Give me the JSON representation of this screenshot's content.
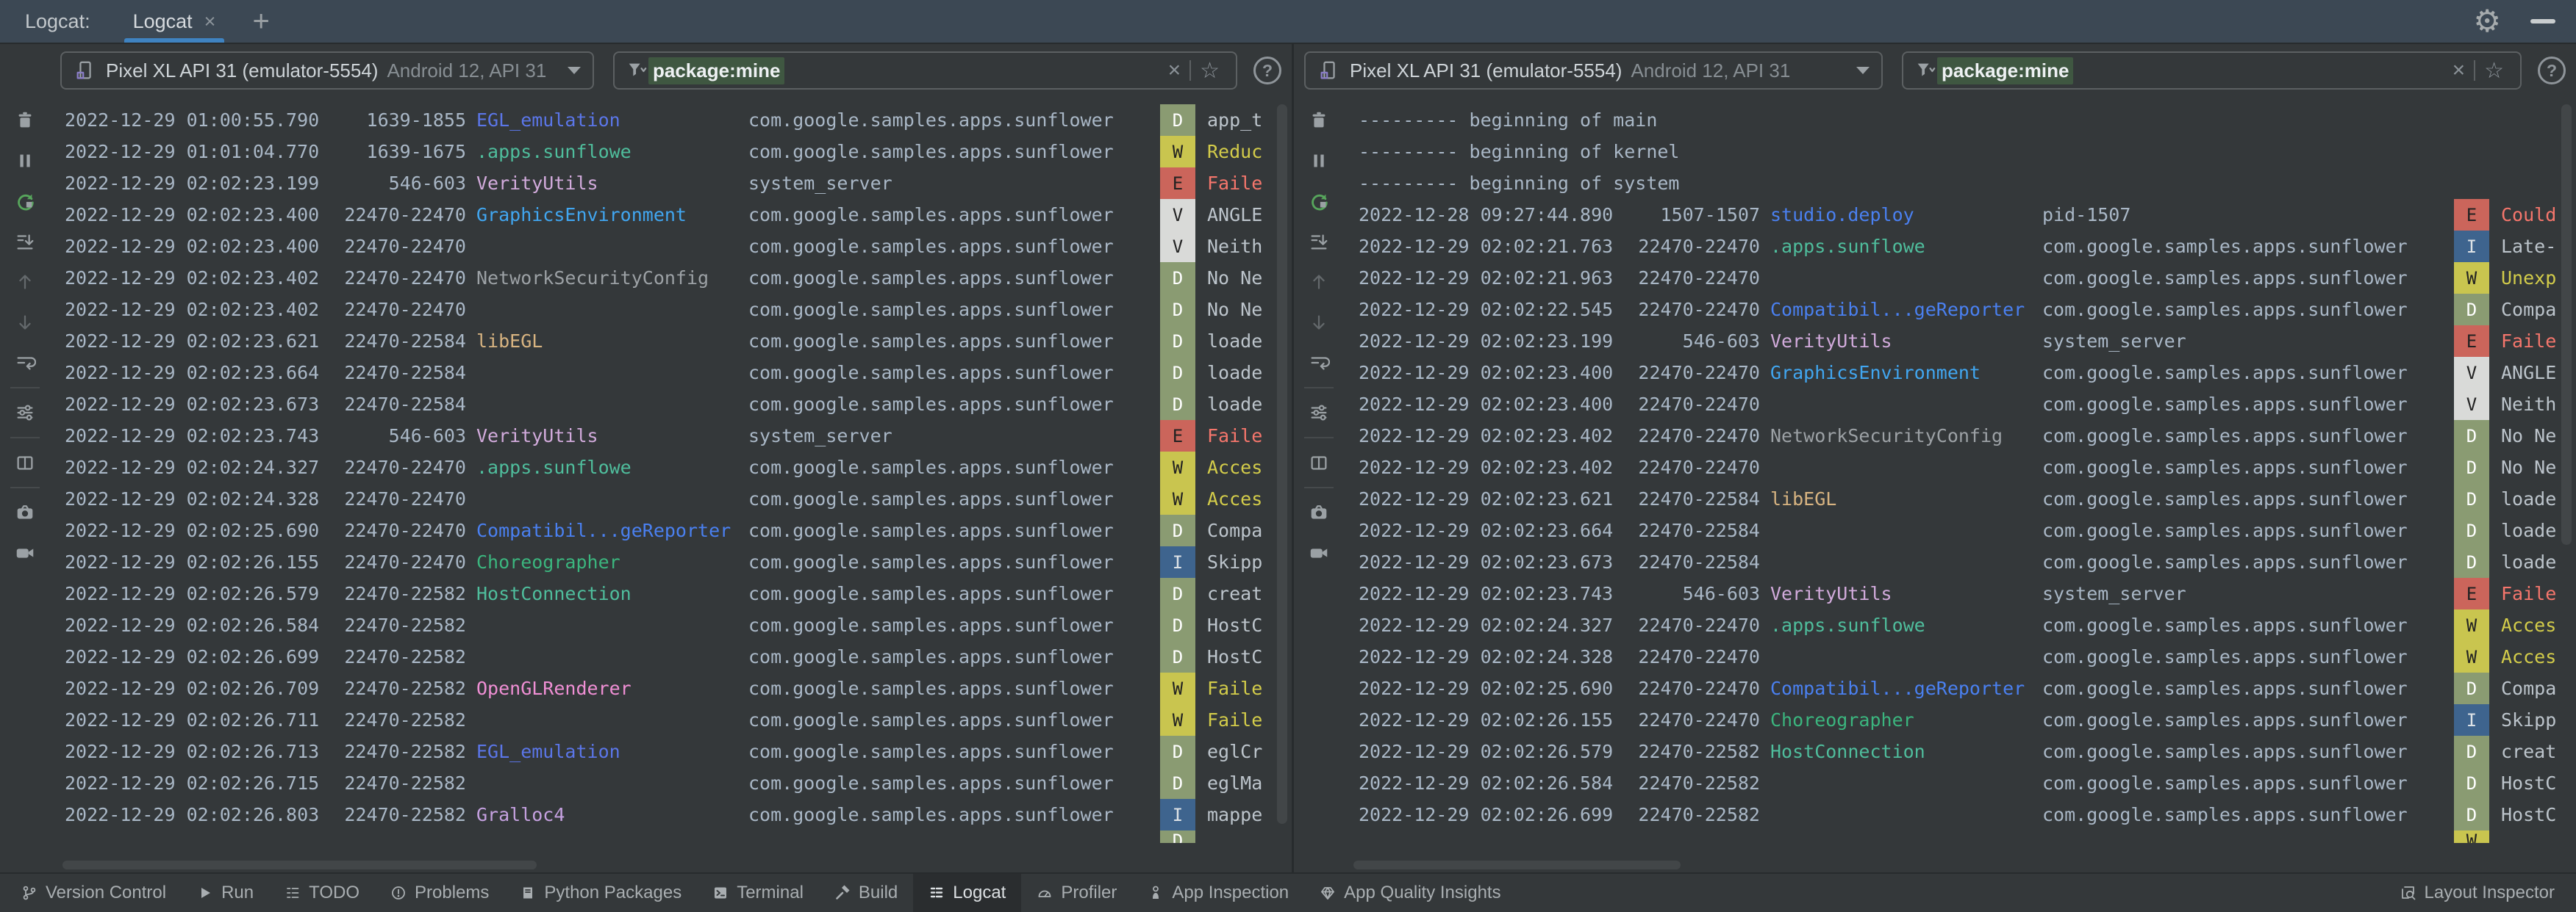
{
  "header": {
    "panel_label": "Logcat:",
    "tab_title": "Logcat",
    "accent_color": "#3f83c1"
  },
  "glyphs": {
    "close": "×",
    "add": "+",
    "clear": "×",
    "favorite": "☆",
    "help": "?",
    "gear": "⚙",
    "filter_caret": "▾"
  },
  "toolbar_icons": [
    "clear-logcat",
    "pause-logcat",
    "restart-logcat",
    "scroll-to-end",
    "previous-occurrence",
    "next-occurrence",
    "soft-wrap",
    "sep",
    "logcat-settings",
    "sep",
    "split-panels",
    "sep",
    "screenshot",
    "screen-record"
  ],
  "levels": {
    "D": {
      "bg": "#8a9b72",
      "fg": "#ffffff",
      "msg": "#bcc4cb"
    },
    "W": {
      "bg": "#c9c54f",
      "fg": "#222222",
      "msg": "#d3cc4a"
    },
    "E": {
      "bg": "#cb655b",
      "fg": "#222222",
      "msg": "#f5766c"
    },
    "V": {
      "bg": "#d9dad8",
      "fg": "#222222",
      "msg": "#bcc4cb"
    },
    "I": {
      "bg": "#3e648e",
      "fg": "#dde2e6",
      "msg": "#bcc4cb"
    }
  },
  "tag_colors": {
    "EGL_emulation": "#5b76e8",
    ".apps.sunflowe": "#4fbd9c",
    "VerityUtils": "#d2abdc",
    "GraphicsEnvironment": "#41a6f0",
    "NetworkSecurityConfig": "#9ca1a5",
    "libEGL": "#d8b481",
    "Compatibil...geReporter": "#4a80f0",
    "Choreographer": "#3bb57e",
    "HostConnection": "#4fbd9c",
    "OpenGLRenderer": "#ef8fd4",
    "Gralloc4": "#c5a1e0",
    "studio.deploy": "#4a80f0"
  },
  "panels": [
    {
      "device": {
        "name": "Pixel XL API 31 (emulator-5554)",
        "details": "Android 12, API 31"
      },
      "filter": {
        "value": "package:mine"
      },
      "rows": [
        {
          "time": "2022-12-29 01:00:55.790",
          "pid": "1639-1855",
          "tag": "EGL_emulation",
          "package": "com.google.samples.apps.sunflower",
          "level": "D",
          "message": "app_t"
        },
        {
          "time": "2022-12-29 01:01:04.770",
          "pid": "1639-1675",
          "tag": ".apps.sunflowe",
          "package": "com.google.samples.apps.sunflower",
          "level": "W",
          "message": "Reduc"
        },
        {
          "time": "2022-12-29 02:02:23.199",
          "pid": "546-603",
          "tag": "VerityUtils",
          "package": "system_server",
          "level": "E",
          "message": "Faile"
        },
        {
          "time": "2022-12-29 02:02:23.400",
          "pid": "22470-22470",
          "tag": "GraphicsEnvironment",
          "package": "com.google.samples.apps.sunflower",
          "level": "V",
          "message": "ANGLE"
        },
        {
          "time": "2022-12-29 02:02:23.400",
          "pid": "22470-22470",
          "tag": "",
          "package": "com.google.samples.apps.sunflower",
          "level": "V",
          "message": "Neith"
        },
        {
          "time": "2022-12-29 02:02:23.402",
          "pid": "22470-22470",
          "tag": "NetworkSecurityConfig",
          "package": "com.google.samples.apps.sunflower",
          "level": "D",
          "message": "No Ne"
        },
        {
          "time": "2022-12-29 02:02:23.402",
          "pid": "22470-22470",
          "tag": "",
          "package": "com.google.samples.apps.sunflower",
          "level": "D",
          "message": "No Ne"
        },
        {
          "time": "2022-12-29 02:02:23.621",
          "pid": "22470-22584",
          "tag": "libEGL",
          "package": "com.google.samples.apps.sunflower",
          "level": "D",
          "message": "loade"
        },
        {
          "time": "2022-12-29 02:02:23.664",
          "pid": "22470-22584",
          "tag": "",
          "package": "com.google.samples.apps.sunflower",
          "level": "D",
          "message": "loade"
        },
        {
          "time": "2022-12-29 02:02:23.673",
          "pid": "22470-22584",
          "tag": "",
          "package": "com.google.samples.apps.sunflower",
          "level": "D",
          "message": "loade"
        },
        {
          "time": "2022-12-29 02:02:23.743",
          "pid": "546-603",
          "tag": "VerityUtils",
          "package": "system_server",
          "level": "E",
          "message": "Faile"
        },
        {
          "time": "2022-12-29 02:02:24.327",
          "pid": "22470-22470",
          "tag": ".apps.sunflowe",
          "package": "com.google.samples.apps.sunflower",
          "level": "W",
          "message": "Acces"
        },
        {
          "time": "2022-12-29 02:02:24.328",
          "pid": "22470-22470",
          "tag": "",
          "package": "com.google.samples.apps.sunflower",
          "level": "W",
          "message": "Acces"
        },
        {
          "time": "2022-12-29 02:02:25.690",
          "pid": "22470-22470",
          "tag": "Compatibil...geReporter",
          "package": "com.google.samples.apps.sunflower",
          "level": "D",
          "message": "Compa"
        },
        {
          "time": "2022-12-29 02:02:26.155",
          "pid": "22470-22470",
          "tag": "Choreographer",
          "package": "com.google.samples.apps.sunflower",
          "level": "I",
          "message": "Skipp"
        },
        {
          "time": "2022-12-29 02:02:26.579",
          "pid": "22470-22582",
          "tag": "HostConnection",
          "package": "com.google.samples.apps.sunflower",
          "level": "D",
          "message": "creat"
        },
        {
          "time": "2022-12-29 02:02:26.584",
          "pid": "22470-22582",
          "tag": "",
          "package": "com.google.samples.apps.sunflower",
          "level": "D",
          "message": "HostC"
        },
        {
          "time": "2022-12-29 02:02:26.699",
          "pid": "22470-22582",
          "tag": "",
          "package": "com.google.samples.apps.sunflower",
          "level": "D",
          "message": "HostC"
        },
        {
          "time": "2022-12-29 02:02:26.709",
          "pid": "22470-22582",
          "tag": "OpenGLRenderer",
          "package": "com.google.samples.apps.sunflower",
          "level": "W",
          "message": "Faile"
        },
        {
          "time": "2022-12-29 02:02:26.711",
          "pid": "22470-22582",
          "tag": "",
          "package": "com.google.samples.apps.sunflower",
          "level": "W",
          "message": "Faile"
        },
        {
          "time": "2022-12-29 02:02:26.713",
          "pid": "22470-22582",
          "tag": "EGL_emulation",
          "package": "com.google.samples.apps.sunflower",
          "level": "D",
          "message": "eglCr"
        },
        {
          "time": "2022-12-29 02:02:26.715",
          "pid": "22470-22582",
          "tag": "",
          "package": "com.google.samples.apps.sunflower",
          "level": "D",
          "message": "eglMa"
        },
        {
          "time": "2022-12-29 02:02:26.803",
          "pid": "22470-22582",
          "tag": "Gralloc4",
          "package": "com.google.samples.apps.sunflower",
          "level": "I",
          "message": "mappe"
        },
        {
          "partial": true,
          "level": "D"
        }
      ]
    },
    {
      "device": {
        "name": "Pixel XL API 31 (emulator-5554)",
        "details": "Android 12, API 31"
      },
      "filter": {
        "value": "package:mine"
      },
      "rows": [
        {
          "banner": "--------- beginning of main"
        },
        {
          "banner": "--------- beginning of kernel"
        },
        {
          "banner": "--------- beginning of system"
        },
        {
          "time": "2022-12-28 09:27:44.890",
          "pid": "1507-1507",
          "tag": "studio.deploy",
          "package": "pid-1507",
          "level": "E",
          "message": "Could"
        },
        {
          "time": "2022-12-29 02:02:21.763",
          "pid": "22470-22470",
          "tag": ".apps.sunflowe",
          "package": "com.google.samples.apps.sunflower",
          "level": "I",
          "message": "Late-"
        },
        {
          "time": "2022-12-29 02:02:21.963",
          "pid": "22470-22470",
          "tag": "",
          "package": "com.google.samples.apps.sunflower",
          "level": "W",
          "message": "Unexp"
        },
        {
          "time": "2022-12-29 02:02:22.545",
          "pid": "22470-22470",
          "tag": "Compatibil...geReporter",
          "package": "com.google.samples.apps.sunflower",
          "level": "D",
          "message": "Compa"
        },
        {
          "time": "2022-12-29 02:02:23.199",
          "pid": "546-603",
          "tag": "VerityUtils",
          "package": "system_server",
          "level": "E",
          "message": "Faile"
        },
        {
          "time": "2022-12-29 02:02:23.400",
          "pid": "22470-22470",
          "tag": "GraphicsEnvironment",
          "package": "com.google.samples.apps.sunflower",
          "level": "V",
          "message": "ANGLE"
        },
        {
          "time": "2022-12-29 02:02:23.400",
          "pid": "22470-22470",
          "tag": "",
          "package": "com.google.samples.apps.sunflower",
          "level": "V",
          "message": "Neith"
        },
        {
          "time": "2022-12-29 02:02:23.402",
          "pid": "22470-22470",
          "tag": "NetworkSecurityConfig",
          "package": "com.google.samples.apps.sunflower",
          "level": "D",
          "message": "No Ne"
        },
        {
          "time": "2022-12-29 02:02:23.402",
          "pid": "22470-22470",
          "tag": "",
          "package": "com.google.samples.apps.sunflower",
          "level": "D",
          "message": "No Ne"
        },
        {
          "time": "2022-12-29 02:02:23.621",
          "pid": "22470-22584",
          "tag": "libEGL",
          "package": "com.google.samples.apps.sunflower",
          "level": "D",
          "message": "loade"
        },
        {
          "time": "2022-12-29 02:02:23.664",
          "pid": "22470-22584",
          "tag": "",
          "package": "com.google.samples.apps.sunflower",
          "level": "D",
          "message": "loade"
        },
        {
          "time": "2022-12-29 02:02:23.673",
          "pid": "22470-22584",
          "tag": "",
          "package": "com.google.samples.apps.sunflower",
          "level": "D",
          "message": "loade"
        },
        {
          "time": "2022-12-29 02:02:23.743",
          "pid": "546-603",
          "tag": "VerityUtils",
          "package": "system_server",
          "level": "E",
          "message": "Faile"
        },
        {
          "time": "2022-12-29 02:02:24.327",
          "pid": "22470-22470",
          "tag": ".apps.sunflowe",
          "package": "com.google.samples.apps.sunflower",
          "level": "W",
          "message": "Acces"
        },
        {
          "time": "2022-12-29 02:02:24.328",
          "pid": "22470-22470",
          "tag": "",
          "package": "com.google.samples.apps.sunflower",
          "level": "W",
          "message": "Acces"
        },
        {
          "time": "2022-12-29 02:02:25.690",
          "pid": "22470-22470",
          "tag": "Compatibil...geReporter",
          "package": "com.google.samples.apps.sunflower",
          "level": "D",
          "message": "Compa"
        },
        {
          "time": "2022-12-29 02:02:26.155",
          "pid": "22470-22470",
          "tag": "Choreographer",
          "package": "com.google.samples.apps.sunflower",
          "level": "I",
          "message": "Skipp"
        },
        {
          "time": "2022-12-29 02:02:26.579",
          "pid": "22470-22582",
          "tag": "HostConnection",
          "package": "com.google.samples.apps.sunflower",
          "level": "D",
          "message": "creat"
        },
        {
          "time": "2022-12-29 02:02:26.584",
          "pid": "22470-22582",
          "tag": "",
          "package": "com.google.samples.apps.sunflower",
          "level": "D",
          "message": "HostC"
        },
        {
          "time": "2022-12-29 02:02:26.699",
          "pid": "22470-22582",
          "tag": "",
          "package": "com.google.samples.apps.sunflower",
          "level": "D",
          "message": "HostC"
        },
        {
          "partial": true,
          "level": "W"
        }
      ]
    }
  ],
  "status_bar": {
    "left_items": [
      {
        "icon": "version-control",
        "label": "Version Control",
        "active": false
      },
      {
        "icon": "run",
        "label": "Run",
        "active": false
      },
      {
        "icon": "todo",
        "label": "TODO",
        "active": false
      },
      {
        "icon": "problems",
        "label": "Problems",
        "active": false
      },
      {
        "icon": "python-packages",
        "label": "Python Packages",
        "active": false
      },
      {
        "icon": "terminal",
        "label": "Terminal",
        "active": false
      },
      {
        "icon": "build",
        "label": "Build",
        "active": false
      },
      {
        "icon": "logcat",
        "label": "Logcat",
        "active": true
      },
      {
        "icon": "profiler",
        "label": "Profiler",
        "active": false
      },
      {
        "icon": "app-inspection",
        "label": "App Inspection",
        "active": false
      },
      {
        "icon": "app-quality-insights",
        "label": "App Quality Insights",
        "active": false
      }
    ],
    "right_items": [
      {
        "icon": "layout-inspector",
        "label": "Layout Inspector",
        "active": false
      }
    ]
  }
}
